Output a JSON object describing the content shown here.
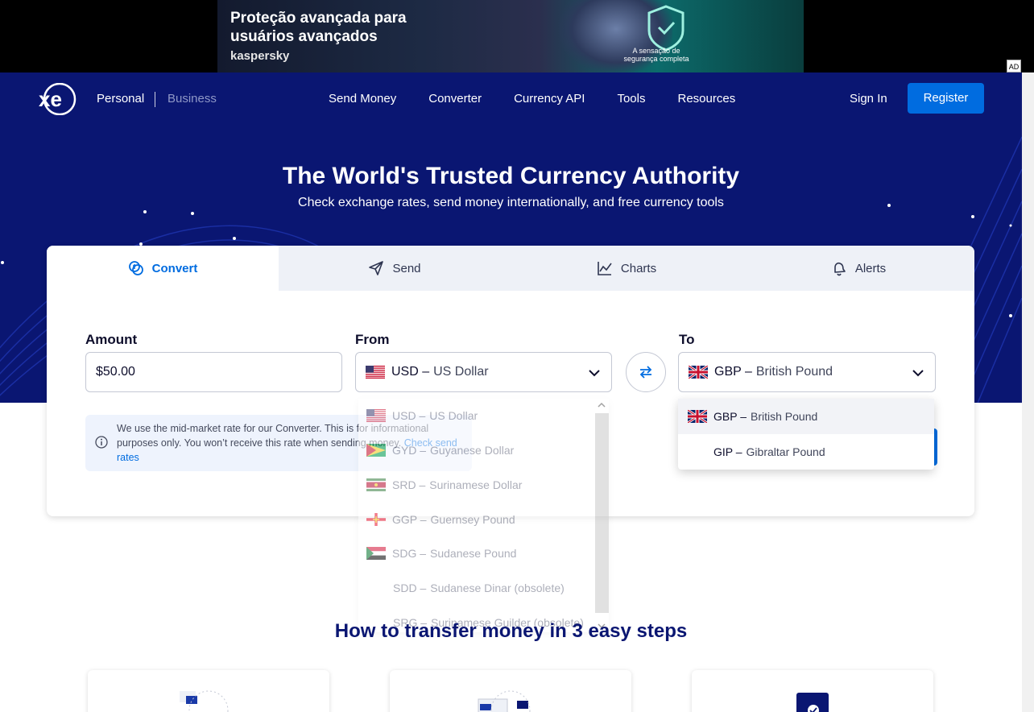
{
  "ad": {
    "title": "Proteção avançada para usuários avançados",
    "brand": "kaspersky",
    "tagline": "A sensação de segurança completa",
    "badge": "AD"
  },
  "nav": {
    "personal": "Personal",
    "business": "Business",
    "links": [
      "Send Money",
      "Converter",
      "Currency API",
      "Tools",
      "Resources"
    ],
    "sign_in": "Sign In",
    "register": "Register"
  },
  "hero": {
    "title": "The World's Trusted Currency Authority",
    "subtitle": "Check exchange rates, send money internationally, and free currency tools"
  },
  "tabs": [
    {
      "label": "Convert",
      "icon": "convert-icon",
      "active": true
    },
    {
      "label": "Send",
      "icon": "send-icon",
      "active": false
    },
    {
      "label": "Charts",
      "icon": "chart-icon",
      "active": false
    },
    {
      "label": "Alerts",
      "icon": "bell-icon",
      "active": false
    }
  ],
  "converter": {
    "amount_label": "Amount",
    "amount_value": "$50.00",
    "from_label": "From",
    "from_code": "USD –",
    "from_name": "US Dollar",
    "to_label": "To",
    "to_code": "GBP –",
    "to_name": "British Pound",
    "info_text": "We use the mid-market rate for our Converter. This is for informational purposes only. You won’t receive this rate when sending money.",
    "info_link": "Check send rates"
  },
  "from_dropdown": [
    {
      "code": "USD –",
      "name": "US Dollar",
      "flag": "us"
    },
    {
      "code": "GYD –",
      "name": "Guyanese Dollar",
      "flag": "gy"
    },
    {
      "code": "SRD –",
      "name": "Surinamese Dollar",
      "flag": "sr"
    },
    {
      "code": "GGP –",
      "name": "Guernsey Pound",
      "flag": "gg"
    },
    {
      "code": "SDG –",
      "name": "Sudanese Pound",
      "flag": "sd"
    },
    {
      "code": "SDD –",
      "name": "Sudanese Dinar (obsolete)",
      "flag": ""
    },
    {
      "code": "SRG –",
      "name": "Surinamese Guilder (obsolete)",
      "flag": ""
    }
  ],
  "to_dropdown": [
    {
      "code": "GBP –",
      "name": "British Pound",
      "flag": "gb",
      "selected": true
    },
    {
      "code": "GIP –",
      "name": "Gibraltar Pound",
      "flag": "",
      "selected": false
    }
  ],
  "steps_title": "How to transfer money in 3 easy steps",
  "colors": {
    "navy": "#0a1672",
    "accent": "#006ce0"
  }
}
